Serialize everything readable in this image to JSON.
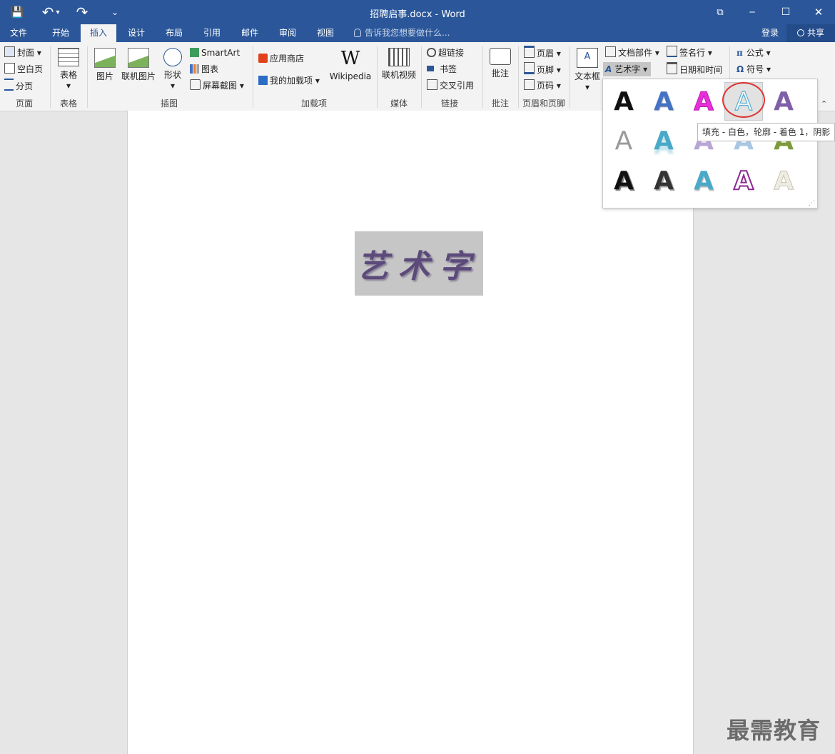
{
  "window": {
    "title": "招聘启事.docx - Word",
    "controls": {
      "restore_glyph": "⧉",
      "minimize_glyph": "─",
      "maximize_glyph": "☐",
      "close_glyph": "✕"
    }
  },
  "quick_access": {
    "save_glyph": "💾",
    "undo_glyph": "↶",
    "redo_glyph": "↷",
    "customize_glyph": "⌄"
  },
  "tabs": [
    {
      "label": "文件"
    },
    {
      "label": "开始"
    },
    {
      "label": "插入"
    },
    {
      "label": "设计"
    },
    {
      "label": "布局"
    },
    {
      "label": "引用"
    },
    {
      "label": "邮件"
    },
    {
      "label": "审阅"
    },
    {
      "label": "视图"
    }
  ],
  "tell_me": {
    "placeholder": "告诉我您想要做什么...",
    "icon": "lightbulb-icon"
  },
  "account": {
    "login": "登录",
    "share": "共享"
  },
  "ribbon": {
    "page": {
      "cover": "封面",
      "blank": "空白页",
      "break": "分页",
      "label": "页面"
    },
    "table": {
      "table": "表格",
      "label": "表格"
    },
    "illustrations": {
      "picture": "图片",
      "online_picture": "联机图片",
      "shapes": "形状",
      "smartart": "SmartArt",
      "chart": "图表",
      "screenshot": "屏幕截图",
      "label": "插图"
    },
    "addins": {
      "store": "应用商店",
      "my_addins": "我的加载项",
      "wikipedia": "Wikipedia",
      "label": "加载项"
    },
    "media": {
      "online_video": "联机视频",
      "label": "媒体"
    },
    "links": {
      "hyperlink": "超链接",
      "bookmark": "书签",
      "crossref": "交叉引用",
      "label": "链接"
    },
    "comments": {
      "comment": "批注",
      "label": "批注"
    },
    "header_footer": {
      "header": "页眉",
      "footer": "页脚",
      "page_number": "页码",
      "label": "页眉和页脚"
    },
    "text": {
      "textbox": "文本框",
      "quick_parts": "文档部件",
      "wordart": "艺术字",
      "signature": "签名行",
      "datetime": "日期和时间"
    },
    "symbols": {
      "equation": "公式",
      "symbol": "符号"
    }
  },
  "document": {
    "wordart_text": "艺术字"
  },
  "wordart_gallery": {
    "tooltip": "填充 - 白色，轮廓 - 着色 1，阴影",
    "letter": "A",
    "colors": {
      "black": "#111111",
      "blue": "#4472c4",
      "magenta": "#e52fd7",
      "outline_teal": "#5aaed0",
      "purple": "#7f5fa8",
      "gray": "#9a9a9a",
      "teal": "#4aa9c9",
      "lavender": "#b7a6d6",
      "lightblue": "#a9c6e3",
      "olive": "#7d9b3a",
      "darkpurple": "#8b2a91",
      "cream": "#d8d4c4",
      "highlight_ring": "#e03030"
    }
  },
  "watermark": "最需教育"
}
